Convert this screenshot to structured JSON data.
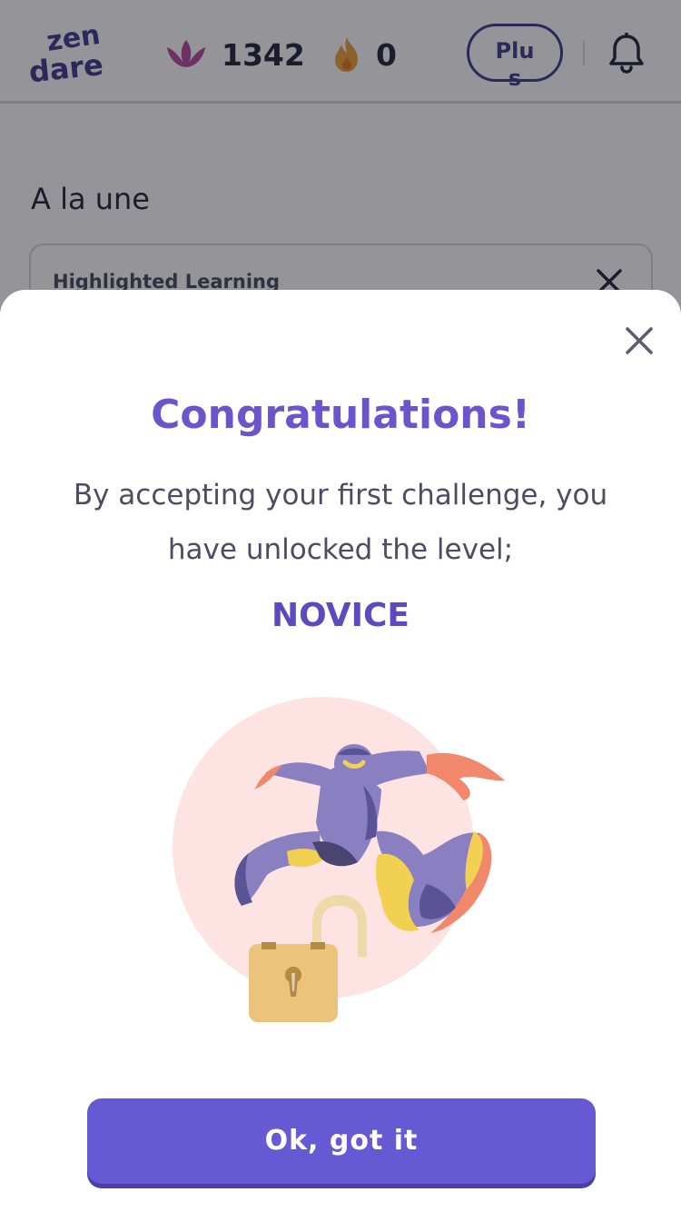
{
  "header": {
    "logo_text": "zen dare",
    "lotus_count": "1342",
    "streak_count": "0",
    "plus_label": "Plus"
  },
  "main": {
    "section_title": "A la une",
    "card_label": "Highlighted Learning"
  },
  "modal": {
    "title": "Congratulations!",
    "message": "By accepting your first challenge, you have unlocked the level;",
    "level": "NOVICE",
    "button_label": "Ok, got it"
  },
  "colors": {
    "accent": "#6a55cc",
    "button": "#6758d3",
    "logo": "#3f3a8f",
    "lotus": "#b84a9e",
    "flame": "#f0a13a"
  },
  "icons": [
    "lotus-icon",
    "flame-icon",
    "bell-icon",
    "close-icon",
    "unlocked-padlock-icon"
  ]
}
